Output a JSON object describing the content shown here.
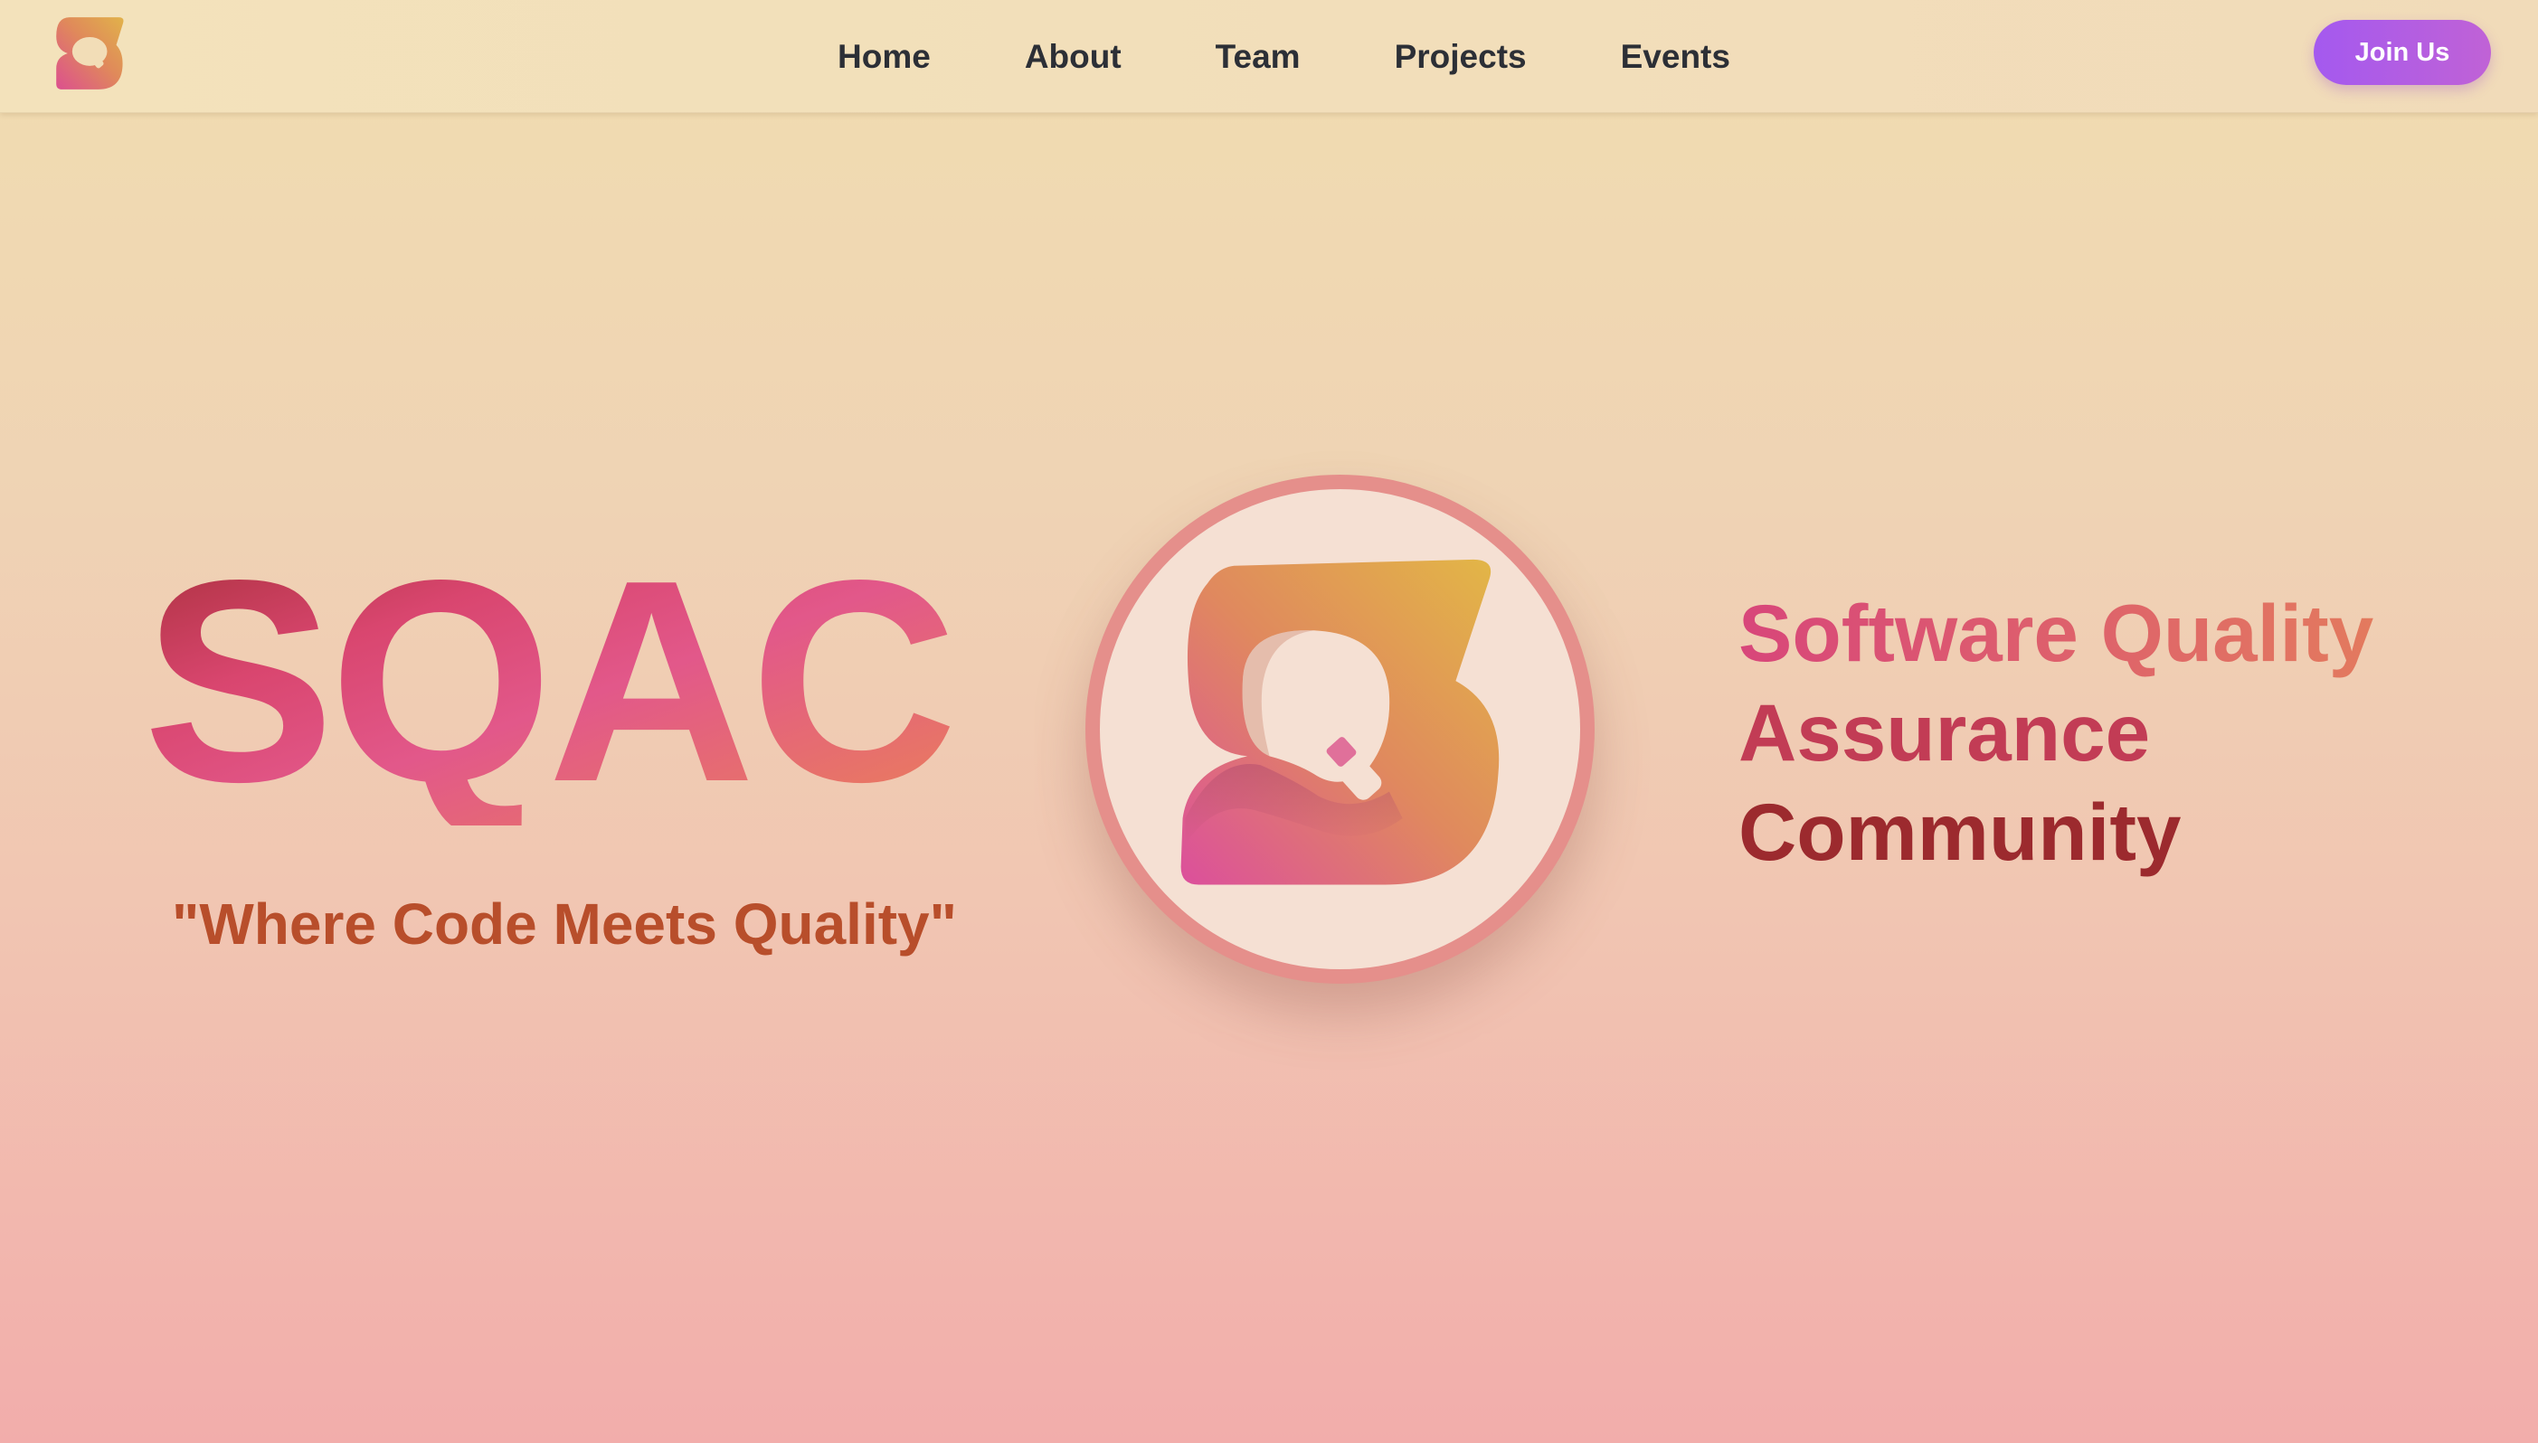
{
  "nav": {
    "logo_icon": "sqac-logo-icon",
    "links": [
      "Home",
      "About",
      "Team",
      "Projects",
      "Events"
    ],
    "join_label": "Join Us"
  },
  "hero": {
    "title": "SQAC",
    "tagline": "\"Where Code Meets Quality\"",
    "logo_icon": "sqac-logo-icon",
    "subtitle_lines": [
      "Software Quality",
      "Assurance",
      "Community"
    ]
  },
  "colors": {
    "accent_purple": "#a459ef",
    "title_pink": "#e2588a",
    "tagline_orange": "#b84e2b",
    "community_red": "#9c2a2e"
  }
}
